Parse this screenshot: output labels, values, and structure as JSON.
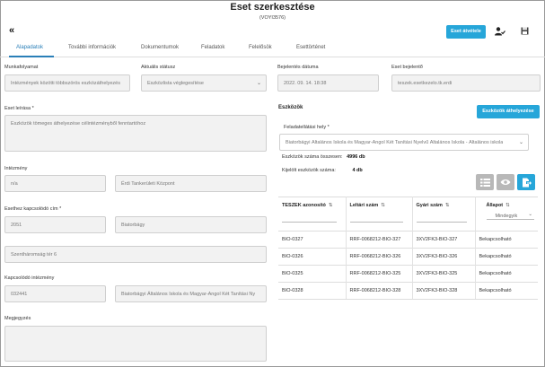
{
  "header": {
    "title": "Eset szerkesztése",
    "subtitle": "(VOYI3576)",
    "back_icon": "«",
    "take_over_label": "Eset átvétele"
  },
  "tabs": [
    {
      "label": "Alapadatok",
      "active": true
    },
    {
      "label": "További információk"
    },
    {
      "label": "Dokumentumok"
    },
    {
      "label": "Feladatok"
    },
    {
      "label": "Felelősök"
    },
    {
      "label": "Esettörténet"
    }
  ],
  "form": {
    "workflow": {
      "label": "Munkafolyamat",
      "value": "Intézmények közötti többszörös eszközáthelyezés"
    },
    "status": {
      "label": "Aktuális státusz",
      "value": "Eszközlista véglegesítése"
    },
    "reported_date": {
      "label": "Bejelentés dátuma",
      "value": "2022. 09. 14. 18:38"
    },
    "reporter": {
      "label": "Eset bejelentő",
      "value": "teszek.esetkezelo.tk.erdi"
    },
    "description": {
      "label": "Eset leírása *",
      "value": "Eszközök tömeges áthelyezése célintézményből fenntartóhoz"
    },
    "institution": {
      "label": "Intézmény",
      "code": "n/a",
      "name": "Érdi Tankerületi Központ"
    },
    "address": {
      "label": "Esethez kapcsolódó cím *",
      "zip": "2051",
      "city": "Biatorbágy",
      "street": "Szentháromság tér 6"
    },
    "related_institution": {
      "label": "Kapcsolódó intézmény",
      "code": "032441",
      "name": "Biatorbágyi Általános Iskola és Magyar-Angol Két Tanítási Ny"
    },
    "remark": {
      "label": "Megjegyzés",
      "value": ""
    }
  },
  "devices": {
    "title": "Eszközök",
    "relocate_label": "Eszközök áthelyezése",
    "task_location_label": "Feladatellátási hely *",
    "task_location_value": "Biatorbágyi Általános Iskola és Magyar-Angol Két Tanítási Nyelvű Általános Iskola - Általános iskola",
    "total_label": "Eszközök száma összesen:",
    "total_value": "4996 db",
    "selected_label": "Kijelölt eszközök száma:",
    "selected_value": "4 db",
    "columns": [
      "TESZEK azonosító",
      "Leltári szám",
      "Gyári szám",
      "Állapot"
    ],
    "status_filter": "Mindegyik",
    "rows": [
      {
        "id": "BIO-0327",
        "inv": "RRF-0068212-BIO-327",
        "serial": "3XV2FK3-BIO-327",
        "state": "Bekapcsolható"
      },
      {
        "id": "BIO-0326",
        "inv": "RRF-0068212-BIO-326",
        "serial": "3XV2FK3-BIO-326",
        "state": "Bekapcsolható"
      },
      {
        "id": "BIO-0325",
        "inv": "RRF-0068212-BIO-325",
        "serial": "3XV2FK3-BIO-325",
        "state": "Bekapcsolható"
      },
      {
        "id": "BIO-0328",
        "inv": "RRF-0068212-BIO-328",
        "serial": "3XV2FK3-BIO-328",
        "state": "Bekapcsolható"
      }
    ]
  },
  "colors": {
    "accent": "#26a6d9",
    "tab_active": "#2a7fb8"
  }
}
